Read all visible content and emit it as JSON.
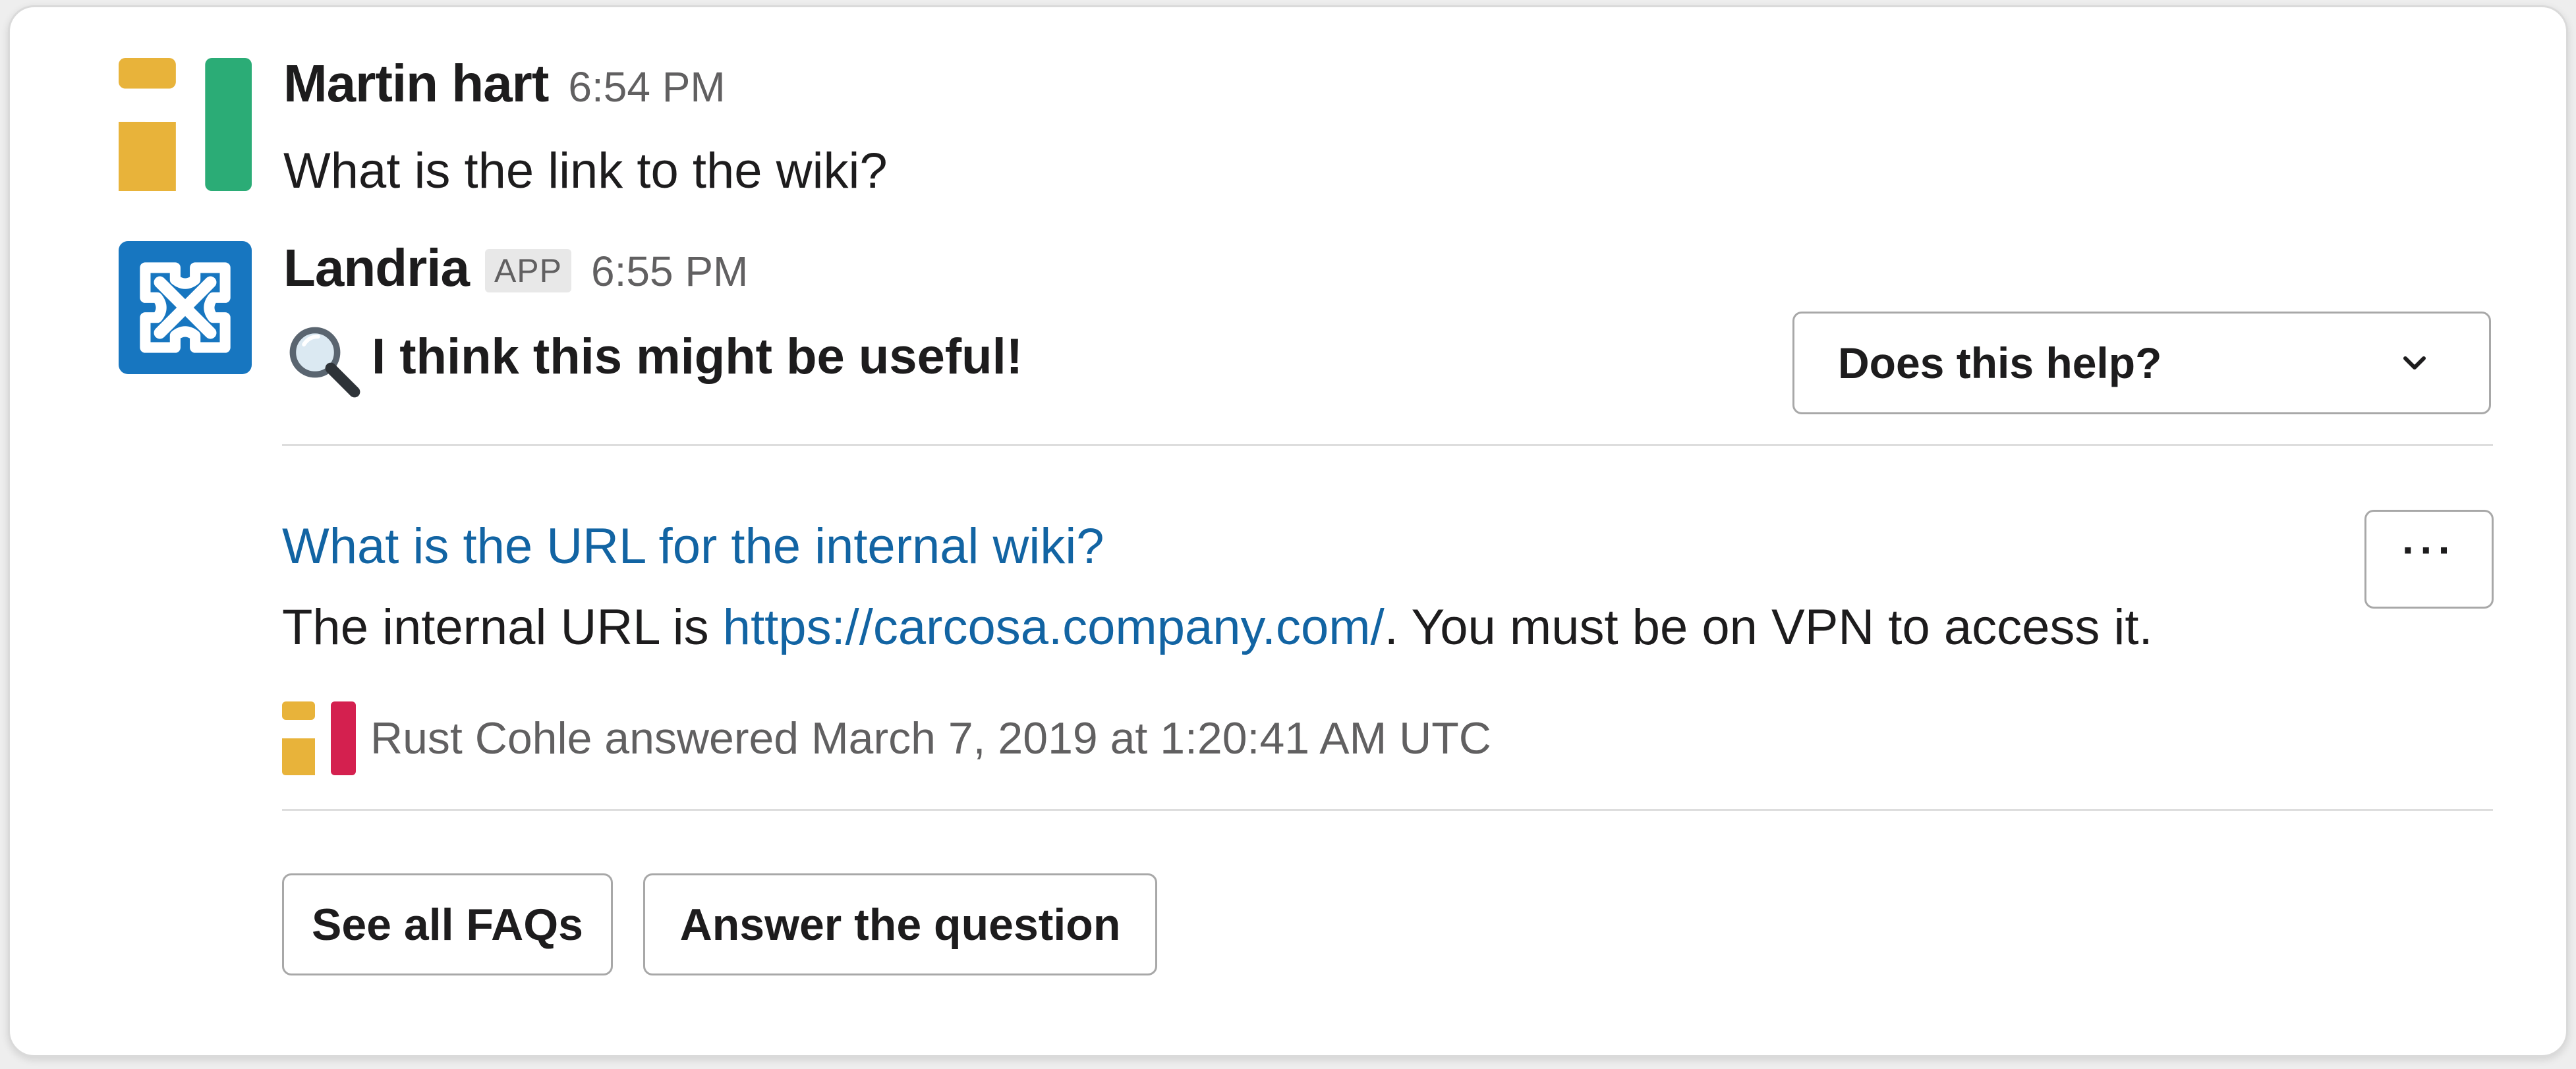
{
  "messages": [
    {
      "author": "Martin hart",
      "time": "6:54 PM",
      "text": "What is the link to the wiki?"
    },
    {
      "author": "Landria",
      "badge": "APP",
      "time": "6:55 PM",
      "text": "I think this might be useful!",
      "emoji_icon": "magnifying-glass-icon"
    }
  ],
  "feedback_select": {
    "label": "Does this help?",
    "icon": "chevron-down-icon"
  },
  "faq": {
    "question": "What is the URL for the internal wiki?",
    "answer_prefix": "The internal URL is ",
    "answer_link": "https://carcosa.company.com/",
    "answer_suffix": ". You must be on VPN to access it.",
    "more_label": "···",
    "answered_by": "Rust Cohle answered March 7, 2019 at 1:20:41 AM UTC"
  },
  "actions": {
    "see_all_faqs": "See all FAQs",
    "answer_question": "Answer the question"
  },
  "colors": {
    "link": "#1264a3",
    "avatar_yellow": "#e8b33a",
    "avatar_green": "#2bac76",
    "avatar_red": "#d4204f",
    "landria_blue": "#1776c0"
  }
}
